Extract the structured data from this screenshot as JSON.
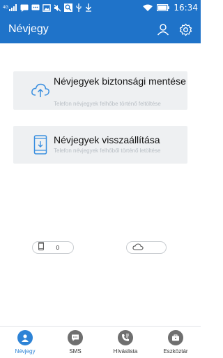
{
  "status_bar": {
    "network_label": "4G",
    "time": "16:34",
    "icons": [
      "signal-icon",
      "message-icon",
      "chat-icon",
      "image-icon",
      "mute-icon",
      "search-icon",
      "usb-icon",
      "download-icon",
      "wifi-icon",
      "battery-icon"
    ]
  },
  "app_bar": {
    "title": "Névjegy",
    "actions": [
      "account-icon",
      "settings-icon"
    ]
  },
  "cards": {
    "backup": {
      "title": "Névjegyek biztonsági mentése",
      "subtitle": "Telefon névjegyek felhőbe történő feltöltése",
      "icon": "cloud-upload-icon"
    },
    "restore": {
      "title": "Névjegyek visszaállítása",
      "subtitle": "Telefon névjegyek felhőből történő letöltése",
      "icon": "phone-download-icon"
    }
  },
  "counters": {
    "phone": {
      "icon": "phone-icon",
      "count": "0"
    },
    "cloud": {
      "icon": "cloud-icon",
      "count": ""
    }
  },
  "bottom_nav": {
    "items": [
      {
        "label": "Névjegy",
        "icon": "contacts-icon",
        "active": true
      },
      {
        "label": "SMS",
        "icon": "sms-icon",
        "active": false
      },
      {
        "label": "Híváslista",
        "icon": "call-log-icon",
        "active": false
      },
      {
        "label": "Eszköztár",
        "icon": "toolbox-icon",
        "active": false
      }
    ]
  },
  "colors": {
    "primary": "#1f73c9",
    "accent": "#2d83d6",
    "card_bg": "#eef0f2",
    "subtitle": "#b8bec4"
  }
}
